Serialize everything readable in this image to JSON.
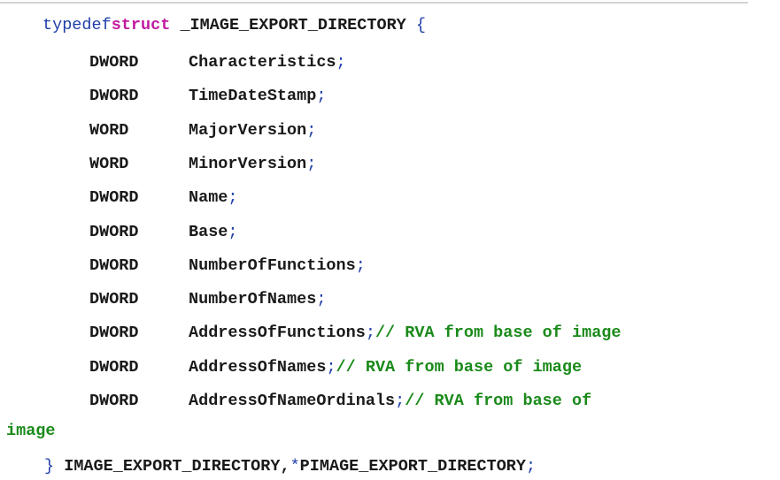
{
  "header": {
    "typedef": "typedef",
    "struct": "struct",
    "name": " _IMAGE_EXPORT_DIRECTORY ",
    "brace": "{"
  },
  "fields": [
    {
      "type": "DWORD",
      "name": "Characteristics",
      "semi": ";",
      "comment": ""
    },
    {
      "type": "DWORD",
      "name": "TimeDateStamp",
      "semi": ";",
      "comment": ""
    },
    {
      "type": "WORD",
      "name": "MajorVersion",
      "semi": ";",
      "comment": ""
    },
    {
      "type": "WORD",
      "name": "MinorVersion",
      "semi": ";",
      "comment": ""
    },
    {
      "type": "DWORD",
      "name": "Name",
      "semi": ";",
      "comment": ""
    },
    {
      "type": "DWORD",
      "name": "Base",
      "semi": ";",
      "comment": ""
    },
    {
      "type": "DWORD",
      "name": "NumberOfFunctions",
      "semi": ";",
      "comment": ""
    },
    {
      "type": "DWORD",
      "name": "NumberOfNames",
      "semi": ";",
      "comment": ""
    },
    {
      "type": "DWORD",
      "name": "AddressOfFunctions",
      "semi": ";",
      "comment": "// RVA from base of image"
    },
    {
      "type": "DWORD",
      "name": "AddressOfNames",
      "semi": ";",
      "comment": "// RVA from base of image"
    },
    {
      "type": "DWORD",
      "name": "AddressOfNameOrdinals",
      "semi": ";",
      "comment": "// RVA from base of"
    }
  ],
  "wrapped_comment": "image",
  "footer": {
    "brace": "}",
    "names": " IMAGE_EXPORT_DIRECTORY,",
    "star": "*",
    "pointer_name": "PIMAGE_EXPORT_DIRECTORY",
    "semi": ";"
  }
}
